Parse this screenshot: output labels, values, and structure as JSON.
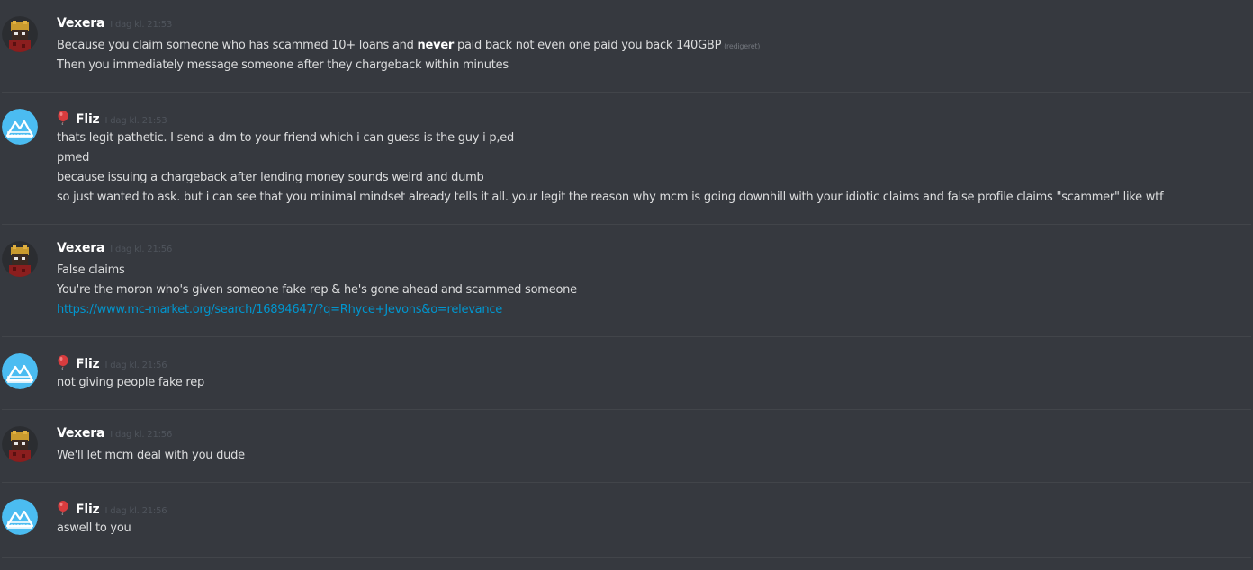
{
  "colors": {
    "background": "#36393f",
    "divider": "#42454a",
    "username": "#ffffff",
    "message_text": "#dcddde",
    "timestamp": "#4f545c",
    "link": "#0096cf",
    "fliz_avatar_bg": "#4bbcf1"
  },
  "messages": [
    {
      "author": "Vexera",
      "timestamp": "I dag kl. 21:53",
      "avatar_icon": "vexera-avatar-icon",
      "lines": {
        "l0_pre": "Because you claim someone who has scammed 10+ loans and ",
        "l0_bold": "never",
        "l0_post": " paid back not even one paid you back 140GBP",
        "l0_edited": "(redigeret)",
        "l1": "Then you immediately message someone after they chargeback within minutes"
      }
    },
    {
      "author": "Fliz",
      "timestamp": "I dag kl. 21:53",
      "avatar_icon": "fliz-avatar-icon",
      "role_icon": "balloon-icon",
      "lines": [
        "thats legit pathetic. I send a dm to your friend which i can guess is the guy i p,ed",
        "pmed",
        "because issuing a chargeback after lending money sounds weird and dumb",
        "so just wanted to ask. but i can see that you minimal mindset already tells it all. your legit the reason why mcm is going downhill with your idiotic claims and false profile claims \"scammer\" like wtf"
      ]
    },
    {
      "author": "Vexera",
      "timestamp": "I dag kl. 21:56",
      "avatar_icon": "vexera-avatar-icon",
      "lines": [
        "False claims",
        "You're the moron who's given someone fake rep & he's gone ahead and scammed someone",
        "https://www.mc-market.org/search/16894647/?q=Rhyce+Jevons&o=relevance"
      ]
    },
    {
      "author": "Fliz",
      "timestamp": "I dag kl. 21:56",
      "avatar_icon": "fliz-avatar-icon",
      "role_icon": "balloon-icon",
      "lines": [
        "not giving people fake rep"
      ]
    },
    {
      "author": "Vexera",
      "timestamp": "I dag kl. 21:56",
      "avatar_icon": "vexera-avatar-icon",
      "lines": [
        "We'll let mcm deal with you dude"
      ]
    },
    {
      "author": "Fliz",
      "timestamp": "I dag kl. 21:56",
      "avatar_icon": "fliz-avatar-icon",
      "role_icon": "balloon-icon",
      "lines": [
        "aswell to you"
      ]
    }
  ]
}
